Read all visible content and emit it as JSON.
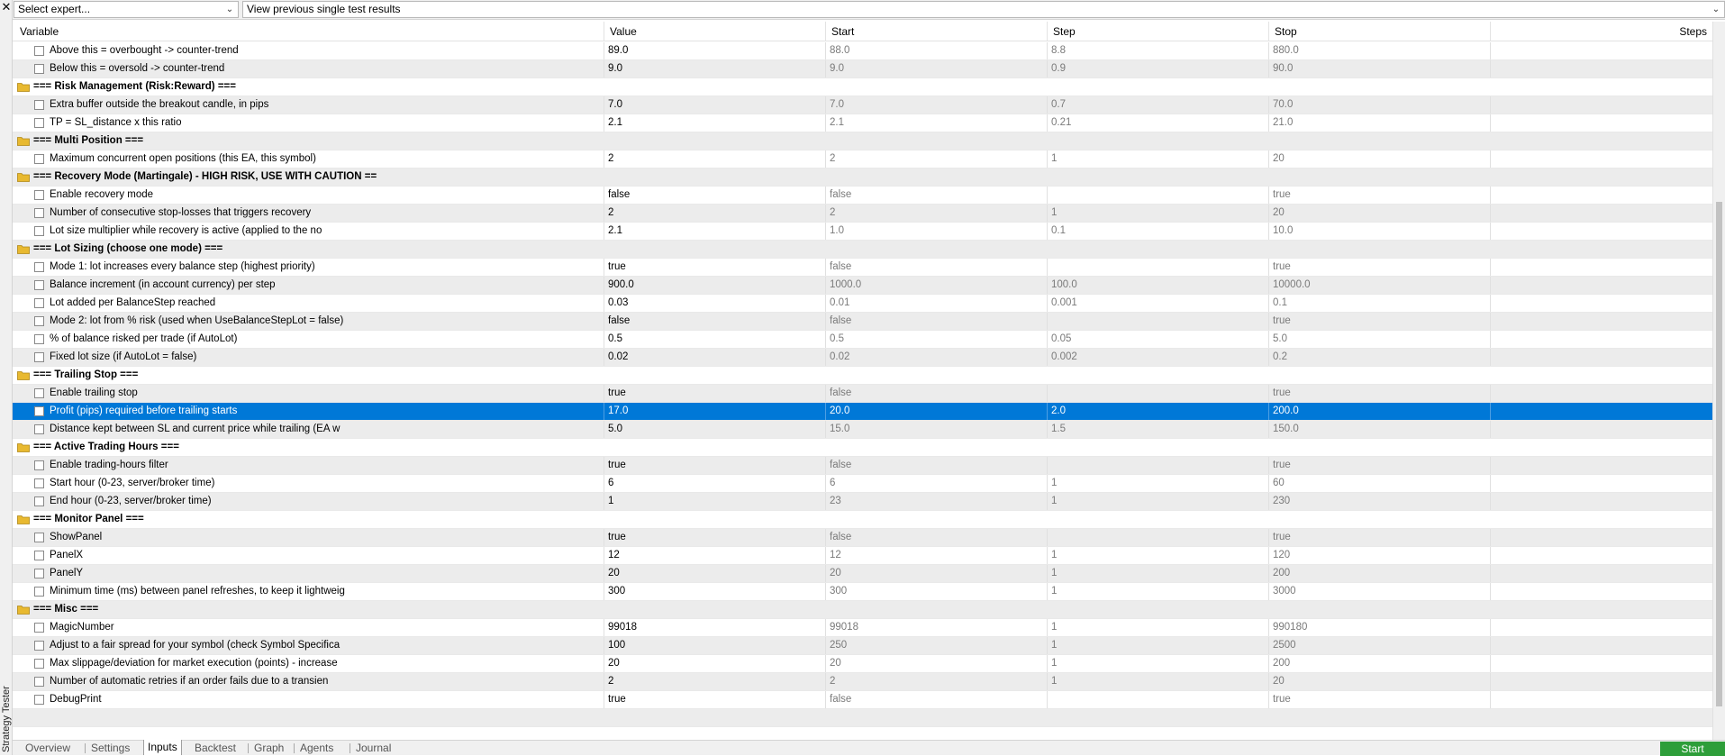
{
  "side_panel": {
    "title": "Strategy Tester",
    "close_glyph": "✕"
  },
  "toolbar": {
    "expert_select": {
      "value": "Select expert...",
      "icon": "chevron-down-icon"
    },
    "results_select": {
      "value": "View previous single test results",
      "icon": "chevron-down-icon"
    }
  },
  "columns": [
    "Variable",
    "Value",
    "Start",
    "Step",
    "Stop",
    "Steps"
  ],
  "rows": [
    {
      "type": "param",
      "label": "Above this = overbought -> counter-trend",
      "value": "89.0",
      "start": "88.0",
      "step": "8.8",
      "stop": "880.0"
    },
    {
      "type": "param",
      "label": "Below this = oversold -> counter-trend",
      "value": "9.0",
      "start": "9.0",
      "step": "0.9",
      "stop": "90.0"
    },
    {
      "type": "group",
      "label": "=== Risk Management (Risk:Reward) ==="
    },
    {
      "type": "param",
      "label": "Extra buffer outside the breakout candle, in pips",
      "value": "7.0",
      "start": "7.0",
      "step": "0.7",
      "stop": "70.0"
    },
    {
      "type": "param",
      "label": "TP = SL_distance x this ratio",
      "value": "2.1",
      "start": "2.1",
      "step": "0.21",
      "stop": "21.0"
    },
    {
      "type": "group",
      "label": "=== Multi Position ==="
    },
    {
      "type": "param",
      "label": "Maximum concurrent open positions (this EA, this symbol)",
      "value": "2",
      "start": "2",
      "step": "1",
      "stop": "20"
    },
    {
      "type": "group",
      "label": "=== Recovery Mode (Martingale) - HIGH RISK, USE WITH CAUTION =="
    },
    {
      "type": "param",
      "label": "Enable recovery mode",
      "value": "false",
      "start": "false",
      "step": "",
      "stop": "true"
    },
    {
      "type": "param",
      "label": "Number of consecutive stop-losses that triggers recovery",
      "value": "2",
      "start": "2",
      "step": "1",
      "stop": "20"
    },
    {
      "type": "param",
      "label": "Lot size multiplier while recovery is active (applied to the no",
      "value": "2.1",
      "start": "1.0",
      "step": "0.1",
      "stop": "10.0"
    },
    {
      "type": "group",
      "label": "=== Lot Sizing (choose one mode) ==="
    },
    {
      "type": "param",
      "label": "Mode 1: lot increases every balance step (highest priority)",
      "value": "true",
      "start": "false",
      "step": "",
      "stop": "true"
    },
    {
      "type": "param",
      "label": "Balance increment (in account currency) per step",
      "value": "900.0",
      "start": "1000.0",
      "step": "100.0",
      "stop": "10000.0"
    },
    {
      "type": "param",
      "label": "Lot added per BalanceStep reached",
      "value": "0.03",
      "start": "0.01",
      "step": "0.001",
      "stop": "0.1"
    },
    {
      "type": "param",
      "label": "Mode 2: lot from % risk (used when UseBalanceStepLot = false)",
      "value": "false",
      "start": "false",
      "step": "",
      "stop": "true"
    },
    {
      "type": "param",
      "label": "% of balance risked per trade (if AutoLot)",
      "value": "0.5",
      "start": "0.5",
      "step": "0.05",
      "stop": "5.0"
    },
    {
      "type": "param",
      "label": "Fixed lot size (if AutoLot = false)",
      "value": "0.02",
      "start": "0.02",
      "step": "0.002",
      "stop": "0.2"
    },
    {
      "type": "group",
      "label": "=== Trailing Stop ==="
    },
    {
      "type": "param",
      "label": "Enable trailing stop",
      "value": "true",
      "start": "false",
      "step": "",
      "stop": "true"
    },
    {
      "type": "param",
      "label": "Profit (pips) required before trailing starts",
      "value": "17.0",
      "start": "20.0",
      "step": "2.0",
      "stop": "200.0",
      "selected": true
    },
    {
      "type": "param",
      "label": "Distance kept between SL and current price while trailing (EA w",
      "value": "5.0",
      "start": "15.0",
      "step": "1.5",
      "stop": "150.0"
    },
    {
      "type": "group",
      "label": "=== Active Trading Hours ==="
    },
    {
      "type": "param",
      "label": "Enable trading-hours filter",
      "value": "true",
      "start": "false",
      "step": "",
      "stop": "true"
    },
    {
      "type": "param",
      "label": "Start hour (0-23, server/broker time)",
      "value": "6",
      "start": "6",
      "step": "1",
      "stop": "60"
    },
    {
      "type": "param",
      "label": "End hour (0-23, server/broker time)",
      "value": "1",
      "start": "23",
      "step": "1",
      "stop": "230"
    },
    {
      "type": "group",
      "label": "=== Monitor Panel ==="
    },
    {
      "type": "param",
      "label": "ShowPanel",
      "value": "true",
      "start": "false",
      "step": "",
      "stop": "true"
    },
    {
      "type": "param",
      "label": "PanelX",
      "value": "12",
      "start": "12",
      "step": "1",
      "stop": "120"
    },
    {
      "type": "param",
      "label": "PanelY",
      "value": "20",
      "start": "20",
      "step": "1",
      "stop": "200"
    },
    {
      "type": "param",
      "label": "Minimum time (ms) between panel refreshes, to keep it lightweig",
      "value": "300",
      "start": "300",
      "step": "1",
      "stop": "3000"
    },
    {
      "type": "group",
      "label": "=== Misc ==="
    },
    {
      "type": "param",
      "label": "MagicNumber",
      "value": "99018",
      "start": "99018",
      "step": "1",
      "stop": "990180"
    },
    {
      "type": "param",
      "label": "Adjust to a fair spread for your symbol (check Symbol Specifica",
      "value": "100",
      "start": "250",
      "step": "1",
      "stop": "2500"
    },
    {
      "type": "param",
      "label": "Max slippage/deviation for market execution (points) - increase",
      "value": "20",
      "start": "20",
      "step": "1",
      "stop": "200"
    },
    {
      "type": "param",
      "label": "Number of automatic retries if an order fails due to a transien",
      "value": "2",
      "start": "2",
      "step": "1",
      "stop": "20"
    },
    {
      "type": "param",
      "label": "DebugPrint",
      "value": "true",
      "start": "false",
      "step": "",
      "stop": "true"
    }
  ],
  "tabs": [
    {
      "label": "Overview",
      "active": false
    },
    {
      "label": "Settings",
      "active": false
    },
    {
      "label": "Inputs",
      "active": true
    },
    {
      "label": "Backtest",
      "active": false
    },
    {
      "label": "Graph",
      "active": false
    },
    {
      "label": "Agents",
      "active": false
    },
    {
      "label": "Journal",
      "active": false
    }
  ],
  "start_button": {
    "label": "Start"
  },
  "colors": {
    "selection": "#0078d7",
    "start_button": "#2e9e3a",
    "folder": "#e8b930"
  }
}
